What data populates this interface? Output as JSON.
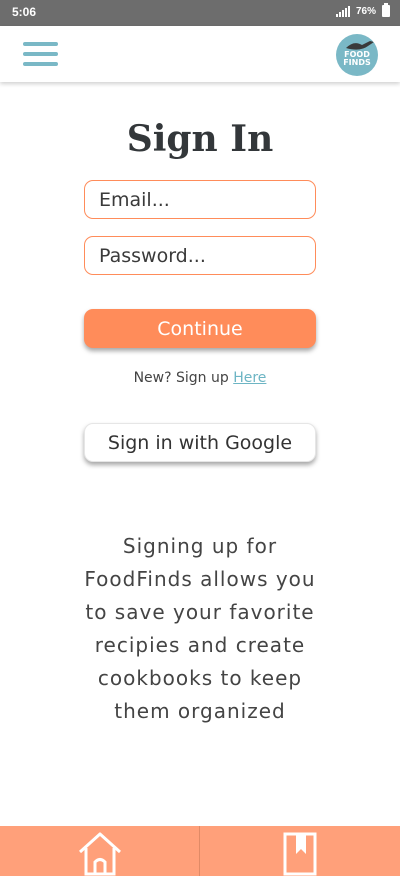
{
  "status_bar": {
    "time": "5:06",
    "battery": "76%"
  },
  "header": {
    "menu_icon": "hamburger-menu-icon",
    "logo_text_line1": "FOOD",
    "logo_text_line2": "FINDS"
  },
  "signin": {
    "title": "Sign In",
    "email_placeholder": "Email...",
    "password_placeholder": "Password...",
    "continue_label": "Continue",
    "new_prefix": "New? Sign up ",
    "signup_link": "Here",
    "google_label": "Sign in with Google"
  },
  "info": {
    "text": "Signing up for FoodFinds allows you to save your favorite recipies and create cookbooks to keep them organized"
  },
  "bottom_nav": {
    "home_icon": "home-icon",
    "bookmark_icon": "bookmark-icon"
  },
  "colors": {
    "accent": "#ff8c5a",
    "nav_bg": "#ffa07a",
    "teal": "#7ab8c6",
    "title": "#33373a"
  }
}
